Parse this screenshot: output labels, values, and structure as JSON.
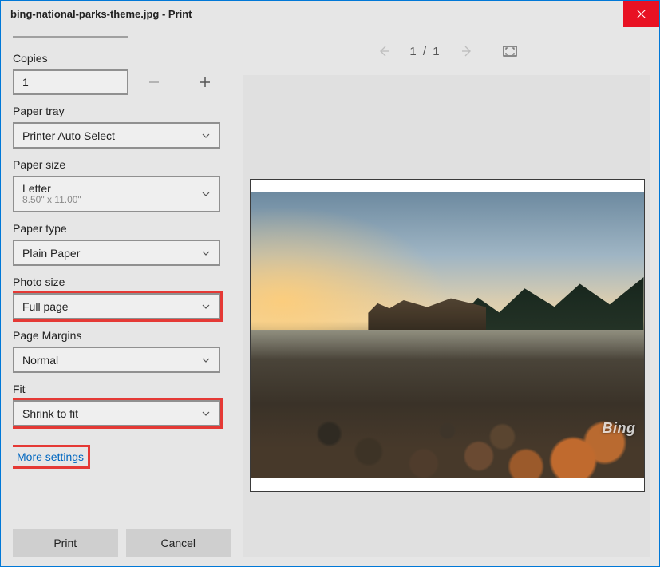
{
  "window": {
    "title": "bing-national-parks-theme.jpg - Print"
  },
  "copies": {
    "label": "Copies",
    "value": "1"
  },
  "paper_tray": {
    "label": "Paper tray",
    "value": "Printer Auto Select"
  },
  "paper_size": {
    "label": "Paper size",
    "value": "Letter",
    "detail": "8.50\" x 11.00\""
  },
  "paper_type": {
    "label": "Paper type",
    "value": "Plain Paper"
  },
  "photo_size": {
    "label": "Photo size",
    "value": "Full page"
  },
  "page_margins": {
    "label": "Page Margins",
    "value": "Normal"
  },
  "fit": {
    "label": "Fit",
    "value": "Shrink to fit"
  },
  "more_settings": "More settings",
  "footer": {
    "print": "Print",
    "cancel": "Cancel"
  },
  "preview": {
    "page_current": "1",
    "page_sep": "/",
    "page_total": "1",
    "watermark": "Bing"
  }
}
